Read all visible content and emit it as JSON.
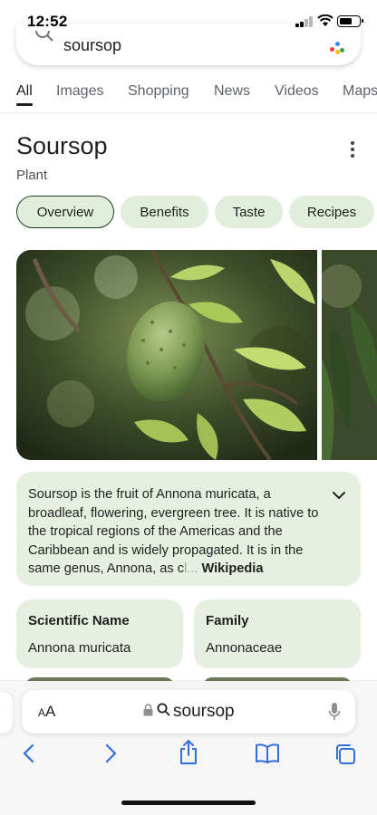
{
  "status_bar": {
    "time": "12:52"
  },
  "search": {
    "query": "soursop"
  },
  "tabs": [
    {
      "label": "All",
      "active": true
    },
    {
      "label": "Images"
    },
    {
      "label": "Shopping"
    },
    {
      "label": "News"
    },
    {
      "label": "Videos"
    },
    {
      "label": "Maps"
    }
  ],
  "entity": {
    "title": "Soursop",
    "subtitle": "Plant"
  },
  "chips": [
    {
      "label": "Overview",
      "selected": true
    },
    {
      "label": "Benefits"
    },
    {
      "label": "Taste"
    },
    {
      "label": "Recipes"
    }
  ],
  "description": {
    "text": "Soursop is the fruit of Annona muricata, a broadleaf, flowering, evergreen tree. It is native to the tropical regions of the Americas and the Caribbean and is widely propagated. It is in the same genus, Annona, as c",
    "faded": "l...",
    "source": "Wikipedia"
  },
  "facts": [
    {
      "label": "Scientific Name",
      "value": "Annona muricata"
    },
    {
      "label": "Family",
      "value": "Annonaceae"
    }
  ],
  "browser": {
    "text_size_label": "AA",
    "url_text": "soursop"
  },
  "colors": {
    "chip_bg": "#e1eedc",
    "card_bg": "#e6f0e1",
    "ios_blue": "#2f6fde"
  },
  "icons": [
    "search-icon",
    "google-dots-icon",
    "more-vert-icon",
    "chevron-down-icon",
    "lock-icon",
    "microphone-icon",
    "back-icon",
    "forward-icon",
    "share-icon",
    "bookmarks-icon",
    "tabs-icon"
  ]
}
